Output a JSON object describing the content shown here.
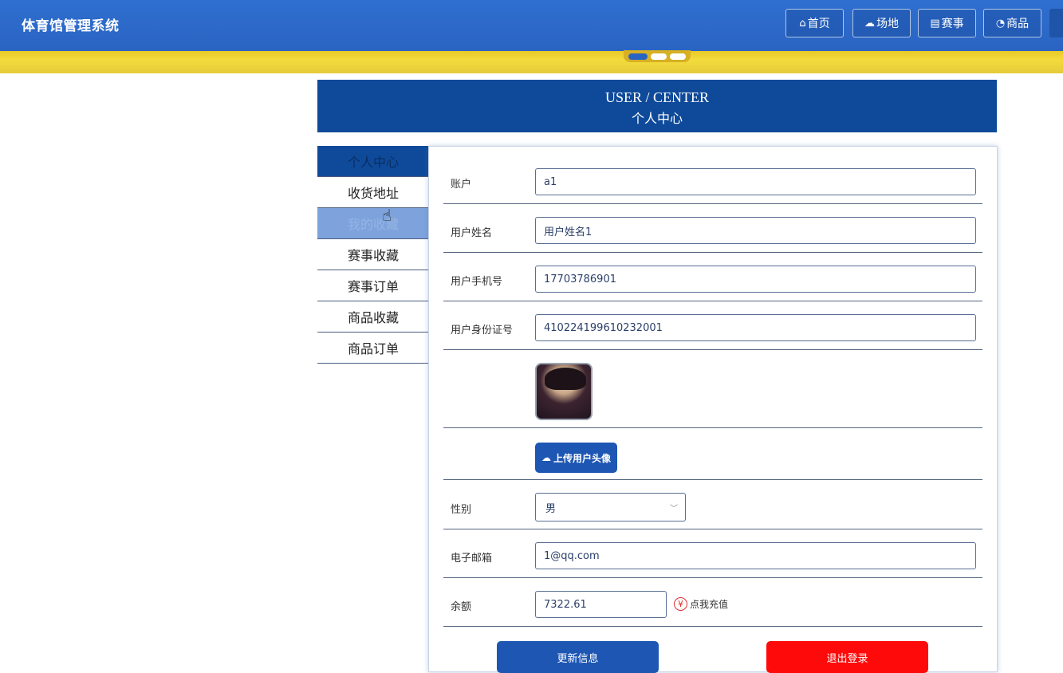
{
  "header": {
    "brand": "体育馆管理系统",
    "nav": [
      {
        "label": "首页",
        "icon": "home-icon"
      },
      {
        "label": "场地",
        "icon": "cloud-icon"
      },
      {
        "label": "赛事",
        "icon": "calendar-icon"
      },
      {
        "label": "商品",
        "icon": "gauge-icon"
      }
    ]
  },
  "banner": {
    "en": "USER / CENTER",
    "cn": "个人中心"
  },
  "sidebar": {
    "items": [
      {
        "label": "个人中心"
      },
      {
        "label": "收货地址"
      },
      {
        "label": "我的收藏"
      },
      {
        "label": "赛事收藏"
      },
      {
        "label": "赛事订单"
      },
      {
        "label": "商品收藏"
      },
      {
        "label": "商品订单"
      }
    ]
  },
  "form": {
    "account": {
      "label": "账户",
      "value": "a1"
    },
    "name": {
      "label": "用户姓名",
      "value": "用户姓名1"
    },
    "phone": {
      "label": "用户手机号",
      "value": "17703786901"
    },
    "idcard": {
      "label": "用户身份证号",
      "value": "410224199610232001"
    },
    "upload_label": "上传用户头像",
    "gender": {
      "label": "性别",
      "value": "男"
    },
    "email": {
      "label": "电子邮箱",
      "value": "1@qq.com"
    },
    "balance": {
      "label": "余额",
      "value": "7322.61",
      "recharge": "点我充值"
    },
    "update_label": "更新信息",
    "logout_label": "退出登录"
  },
  "colors": {
    "header": "#2a64c2",
    "band": "#f0d535",
    "primary": "#1e56b3",
    "danger": "#ff0a0a"
  }
}
